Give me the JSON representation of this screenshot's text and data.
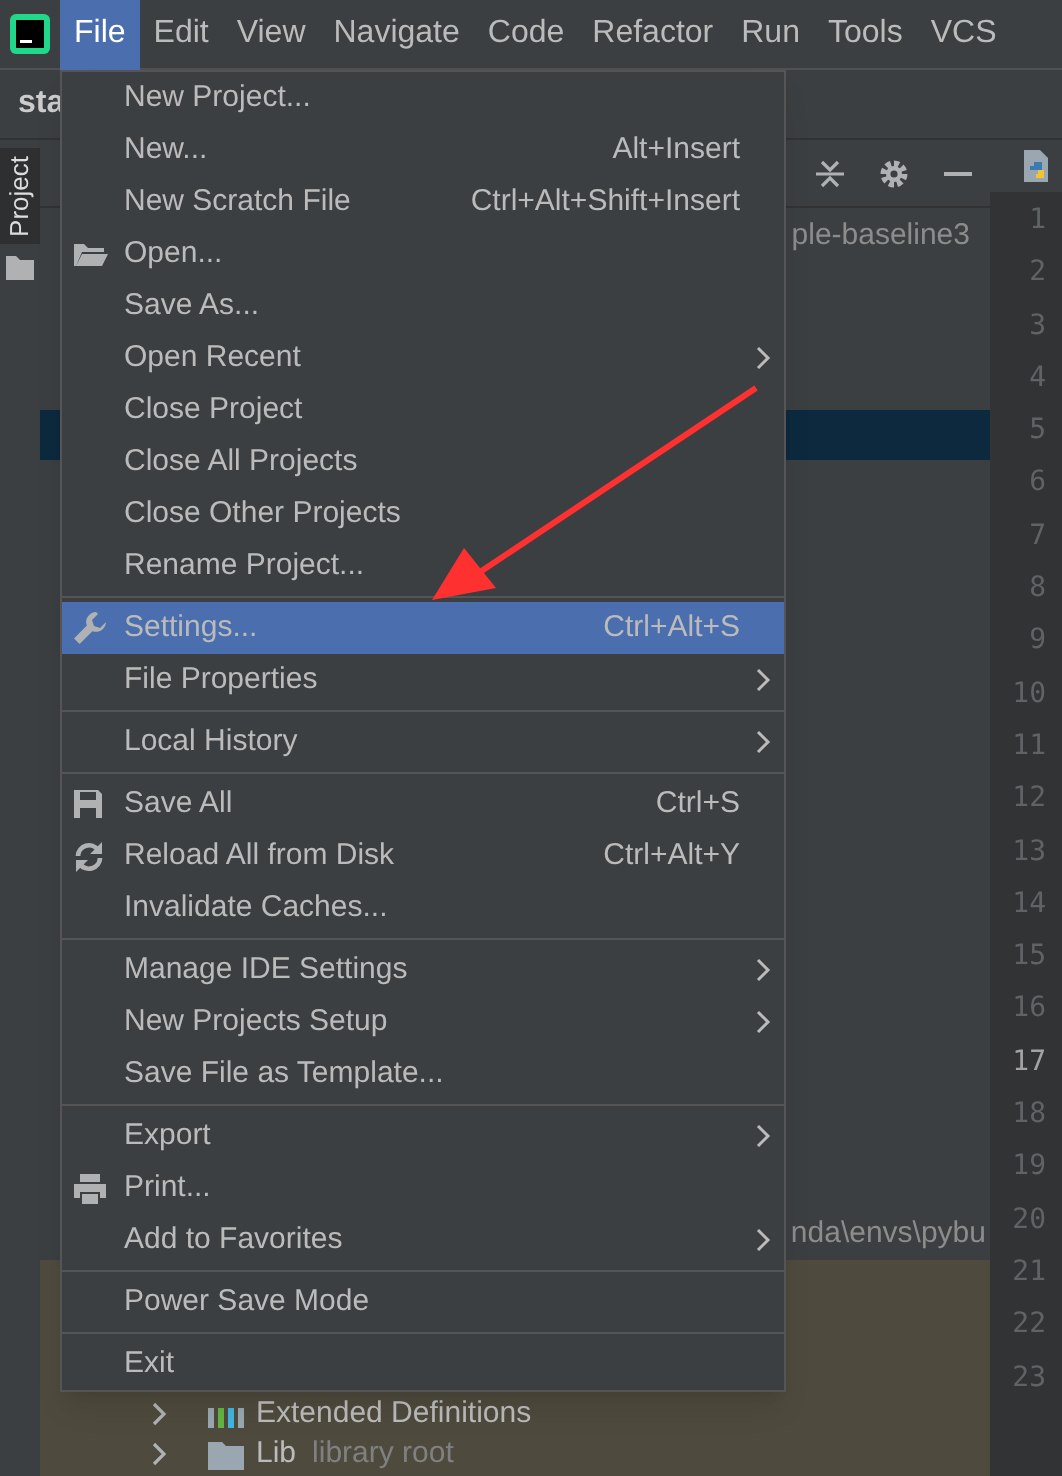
{
  "menu_bar": [
    {
      "label": "File",
      "selected": true
    },
    {
      "label": "Edit",
      "selected": false
    },
    {
      "label": "View",
      "selected": false
    },
    {
      "label": "Navigate",
      "selected": false
    },
    {
      "label": "Code",
      "selected": false
    },
    {
      "label": "Refactor",
      "selected": false
    },
    {
      "label": "Run",
      "selected": false
    },
    {
      "label": "Tools",
      "selected": false
    },
    {
      "label": "VCS",
      "selected": false
    }
  ],
  "project_title": "sta",
  "side_tab": "Project",
  "breadcrumb": "ple-baseline3",
  "path_text": "nda\\envs\\pybu",
  "tree": [
    {
      "label": "Extended Definitions"
    },
    {
      "label": "Lib",
      "note": "library root"
    }
  ],
  "line_numbers": [
    "1",
    "2",
    "3",
    "4",
    "5",
    "6",
    "7",
    "8",
    "9",
    "10",
    "11",
    "12",
    "13",
    "14",
    "15",
    "16",
    "17",
    "18",
    "19",
    "20",
    "21",
    "22",
    "23"
  ],
  "file_menu": [
    {
      "kind": "item",
      "label": "New Project...",
      "selected": false
    },
    {
      "kind": "item",
      "label": "New...",
      "shortcut": "Alt+Insert",
      "selected": false
    },
    {
      "kind": "item",
      "label": "New Scratch File",
      "shortcut": "Ctrl+Alt+Shift+Insert",
      "selected": false
    },
    {
      "kind": "item",
      "label": "Open...",
      "selected": false
    },
    {
      "kind": "item",
      "label": "Save As...",
      "selected": false
    },
    {
      "kind": "item",
      "label": "Open Recent",
      "submenu": true,
      "selected": false
    },
    {
      "kind": "item",
      "label": "Close Project",
      "selected": false
    },
    {
      "kind": "item",
      "label": "Close All Projects",
      "selected": false
    },
    {
      "kind": "item",
      "label": "Close Other Projects",
      "selected": false
    },
    {
      "kind": "item",
      "label": "Rename Project...",
      "selected": false
    },
    {
      "kind": "separator"
    },
    {
      "kind": "item",
      "label": "Settings...",
      "shortcut": "Ctrl+Alt+S",
      "selected": true
    },
    {
      "kind": "item",
      "label": "File Properties",
      "submenu": true,
      "selected": false
    },
    {
      "kind": "separator"
    },
    {
      "kind": "item",
      "label": "Local History",
      "submenu": true,
      "selected": false
    },
    {
      "kind": "separator"
    },
    {
      "kind": "item",
      "label": "Save All",
      "shortcut": "Ctrl+S",
      "selected": false
    },
    {
      "kind": "item",
      "label": "Reload All from Disk",
      "shortcut": "Ctrl+Alt+Y",
      "selected": false
    },
    {
      "kind": "item",
      "label": "Invalidate Caches...",
      "selected": false
    },
    {
      "kind": "separator"
    },
    {
      "kind": "item",
      "label": "Manage IDE Settings",
      "submenu": true,
      "selected": false
    },
    {
      "kind": "item",
      "label": "New Projects Setup",
      "submenu": true,
      "selected": false
    },
    {
      "kind": "item",
      "label": "Save File as Template...",
      "selected": false
    },
    {
      "kind": "separator"
    },
    {
      "kind": "item",
      "label": "Export",
      "submenu": true,
      "selected": false
    },
    {
      "kind": "item",
      "label": "Print...",
      "selected": false
    },
    {
      "kind": "item",
      "label": "Add to Favorites",
      "submenu": true,
      "selected": false
    },
    {
      "kind": "separator"
    },
    {
      "kind": "item",
      "label": "Power Save Mode",
      "selected": false
    },
    {
      "kind": "separator"
    },
    {
      "kind": "item",
      "label": "Exit",
      "selected": false
    }
  ]
}
